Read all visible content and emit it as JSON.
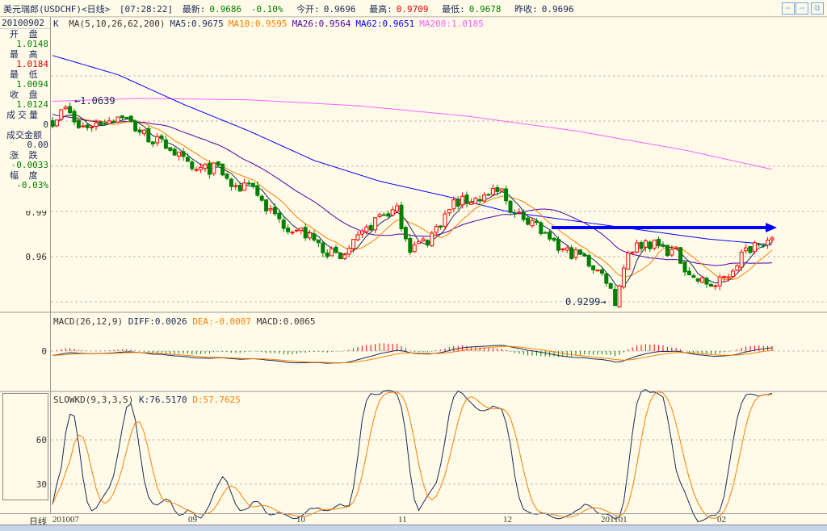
{
  "title": {
    "name": "美元瑞郎(USDCHF)<日线>",
    "time": "[07:28:22]",
    "latest_label": "最新:",
    "latest": "0.9686",
    "change": "-0.10%",
    "open_label": "今开:",
    "open": "0.9696",
    "high_label": "最高:",
    "high": "0.9709",
    "low_label": "最低:",
    "low": "0.9678",
    "prev_label": "昨收:",
    "prev": "0.9696"
  },
  "nav": {
    "back_icon": "⇦",
    "forward_icon": "⇨",
    "window_icon": "⧉"
  },
  "ma_legend": {
    "k": "K",
    "params": "MA(5,10,26,62,200)",
    "ma5": "MA5:0.9675",
    "ma10": "MA10:0.9595",
    "ma26": "MA26:0.9564",
    "ma62": "MA62:0.9651",
    "ma200": "MA200:1.0185"
  },
  "colors": {
    "ma5": "#1a2a5a",
    "ma10": "#ff8000",
    "ma26": "#5000a0",
    "ma62": "#0000ff",
    "ma200": "#ff60ff",
    "up": "#ff0000",
    "down": "#008000"
  },
  "info": {
    "date": "20100902",
    "open_label": "开 盘",
    "open": "1.0148",
    "high_label": "最 高",
    "high": "1.0184",
    "low_label": "最 低",
    "low": "1.0094",
    "close_label": "收 盘",
    "close": "1.0124",
    "vol_label": "成交量",
    "vol": "0",
    "amount_label": "成交金额",
    "amount": "0.00",
    "chg_label": "涨 跌",
    "chg": "-0.0033",
    "pct_label": "幅 度",
    "pct": "-0.03%"
  },
  "axis": {
    "main": [
      "0.99",
      "0.96"
    ],
    "macd": [
      "0"
    ],
    "kd": [
      "60",
      "30"
    ],
    "x_period": "日线",
    "x": [
      "201007",
      "09",
      "10",
      "11",
      "12",
      "201101",
      "02"
    ]
  },
  "annotations": {
    "high": "1.0639",
    "low": "0.9299"
  },
  "macd_legend": {
    "params": "MACD(26,12,9)",
    "diff": "DIFF:0.0026",
    "dea": "DEA:-0.0007",
    "macd": "MACD:0.0065"
  },
  "kd_legend": {
    "params": "SLOWKD(9,3,3,5)",
    "k": "K:76.5170",
    "d": "D:57.7625"
  },
  "chart_data": {
    "type": "candlestick",
    "count": 166,
    "close_keypoints": [
      [
        0,
        1.052
      ],
      [
        3,
        1.06
      ],
      [
        6,
        1.047
      ],
      [
        10,
        1.05
      ],
      [
        16,
        1.056
      ],
      [
        19,
        1.047
      ],
      [
        23,
        1.039
      ],
      [
        27,
        1.034
      ],
      [
        32,
        1.018
      ],
      [
        38,
        1.02
      ],
      [
        42,
        1.004
      ],
      [
        45,
        1.012
      ],
      [
        49,
        0.993
      ],
      [
        53,
        0.982
      ],
      [
        57,
        0.977
      ],
      [
        62,
        0.966
      ],
      [
        66,
        0.958
      ],
      [
        70,
        0.971
      ],
      [
        75,
        0.988
      ],
      [
        79,
        0.991
      ],
      [
        82,
        0.966
      ],
      [
        86,
        0.971
      ],
      [
        92,
        0.996
      ],
      [
        97,
        0.999
      ],
      [
        103,
        1.004
      ],
      [
        106,
        0.988
      ],
      [
        110,
        0.985
      ],
      [
        114,
        0.969
      ],
      [
        117,
        0.964
      ],
      [
        121,
        0.961
      ],
      [
        127,
        0.945
      ],
      [
        129,
        0.9299
      ],
      [
        132,
        0.964
      ],
      [
        136,
        0.97
      ],
      [
        139,
        0.967
      ],
      [
        143,
        0.962
      ],
      [
        147,
        0.945
      ],
      [
        152,
        0.94
      ],
      [
        155,
        0.948
      ],
      [
        158,
        0.961
      ],
      [
        162,
        0.972
      ],
      [
        165,
        0.9686
      ]
    ],
    "ma62_keypoints": [
      [
        0,
        1.096
      ],
      [
        15,
        1.083
      ],
      [
        30,
        1.063
      ],
      [
        45,
        1.045
      ],
      [
        60,
        1.025
      ],
      [
        75,
        1.011
      ],
      [
        90,
        1.001
      ],
      [
        105,
        0.99
      ],
      [
        120,
        0.984
      ],
      [
        135,
        0.978
      ],
      [
        150,
        0.972
      ],
      [
        165,
        0.968
      ]
    ],
    "ma200_keypoints": [
      [
        0,
        1.065
      ],
      [
        20,
        1.067
      ],
      [
        45,
        1.066
      ],
      [
        70,
        1.062
      ],
      [
        95,
        1.055
      ],
      [
        120,
        1.045
      ],
      [
        145,
        1.032
      ],
      [
        165,
        1.019
      ]
    ],
    "y_range": [
      0.92,
      1.11
    ],
    "macd_params": [
      12,
      26,
      9
    ],
    "kd_params": [
      9,
      3,
      3,
      5
    ]
  }
}
